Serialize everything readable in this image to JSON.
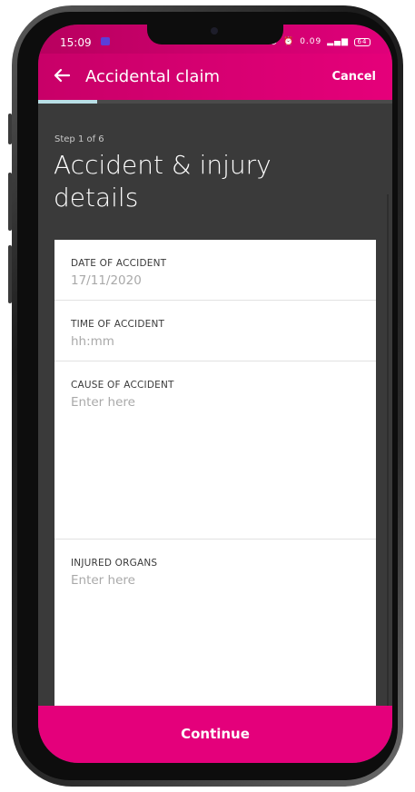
{
  "status_bar": {
    "time": "15:09",
    "icons_text": "0.09",
    "battery": "64"
  },
  "app_bar": {
    "title": "Accidental claim",
    "cancel_label": "Cancel"
  },
  "progress": {
    "step": 1,
    "total": 6,
    "fraction": 0.1667
  },
  "step_label": "Step 1 of 6",
  "page_title": "Accident & injury details",
  "form": {
    "date": {
      "label": "DATE OF ACCIDENT",
      "value": "17/11/2020"
    },
    "time": {
      "label": "TIME OF ACCIDENT",
      "placeholder": "hh:mm"
    },
    "cause": {
      "label": "CAUSE OF ACCIDENT",
      "placeholder": "Enter here"
    },
    "organs": {
      "label": "INJURED ORGANS",
      "placeholder": "Enter here"
    }
  },
  "continue_label": "Continue",
  "colors": {
    "brand": "#e4007b",
    "progress": "#b9dfe6",
    "background": "#3a3a3a"
  }
}
